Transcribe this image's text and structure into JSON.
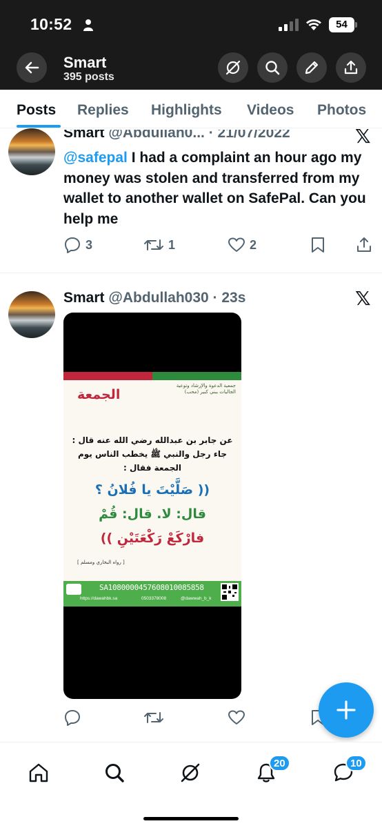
{
  "status_bar": {
    "time": "10:52",
    "battery": "54"
  },
  "header": {
    "title": "Smart",
    "subtitle": "395 posts"
  },
  "tabs": [
    {
      "label": "Posts",
      "active": true
    },
    {
      "label": "Replies"
    },
    {
      "label": "Highlights"
    },
    {
      "label": "Videos"
    },
    {
      "label": "Photos"
    }
  ],
  "tweets": [
    {
      "name": "Smart",
      "meta": "@Abdullah0... · 21/07/2022",
      "mention": "@safepal",
      "text": " I had a complaint an hour ago my money was stolen and transferred from my wallet to another wallet on SafePal.       Can you help me",
      "replies": "3",
      "retweets": "1",
      "likes": "2"
    },
    {
      "name": "Smart",
      "meta": "@Abdullah030 · 23s",
      "poster": {
        "title": "الجمعة",
        "org": "جمعية الدعوة والإرشاد وتوعية الجاليات ببني كبير (محب)",
        "line1": "عن جابر بن عبدالله رضي الله عنه قال :",
        "line2": "جاء رجل والنبي ﷺ يخطب الناس يوم",
        "line3": "الجمعة فقال :",
        "line4": "(( صَلَّيْتَ يا فُلانُ ؟",
        "line5": "قال: لا. قال: قُمْ",
        "line6": "فارْكَعْ رَكْعَتَيْنِ ))",
        "source": "[ رواه البخاري ومسلم ]",
        "iban": "SA1080000457608010085858",
        "website": "https://dawahbk.sa",
        "phone": "0503378008",
        "handle": "@dawwah_b_k"
      }
    }
  ],
  "badges": {
    "notifications": "20",
    "messages": "10"
  }
}
